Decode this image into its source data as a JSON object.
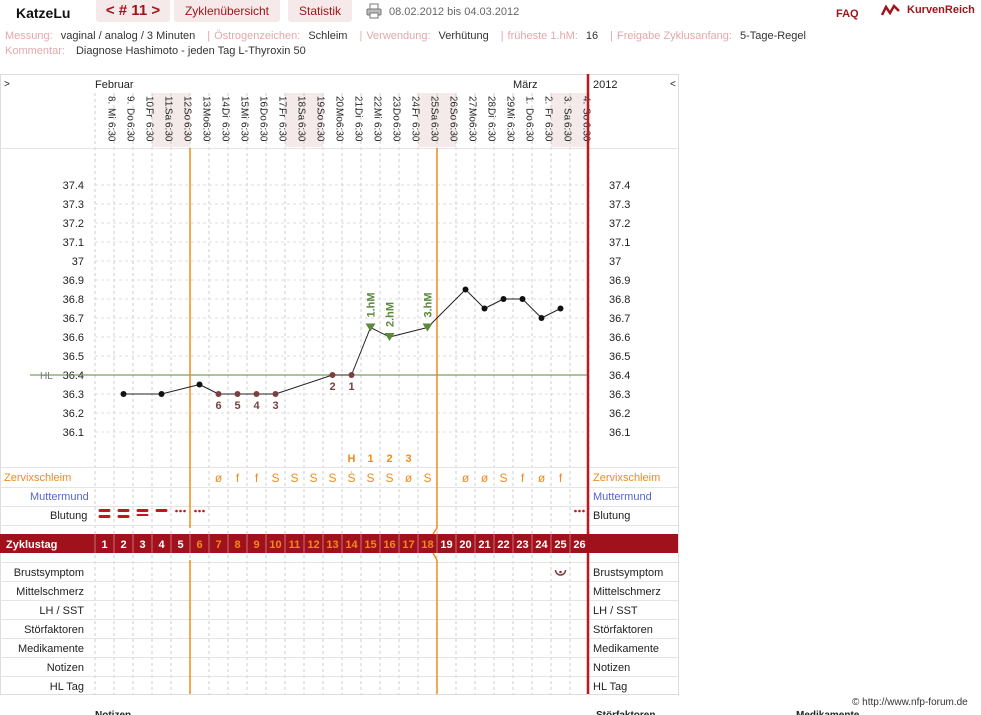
{
  "header": {
    "user": "KatzeLu",
    "cycle_nav": "< # 11 >",
    "tabs": [
      "Zyklenübersicht",
      "Statistik"
    ],
    "date_range": "08.02.2012 bis 04.03.2012",
    "faq": "FAQ",
    "brand": "KurvenReich"
  },
  "meta": {
    "line1": [
      {
        "k": "Messung:",
        "v": "vaginal / analog / 3 Minuten"
      },
      {
        "k": "Östrogenzeichen:",
        "v": "Schleim"
      },
      {
        "k": "Verwendung:",
        "v": "Verhütung"
      },
      {
        "k": "früheste 1.hM:",
        "v": "16"
      },
      {
        "k": "Freigabe Zyklusanfang:",
        "v": "5-Tage-Regel"
      }
    ],
    "comment_key": "Kommentar:",
    "comment": "Diagnose Hashimoto - jeden Tag L-Thyroxin 50"
  },
  "calendar": {
    "left_arrow": ">",
    "right_arrow": "<",
    "year": "2012",
    "months": [
      {
        "name": "Februar",
        "start_index": 0
      },
      {
        "name": "März",
        "start_index": 22
      }
    ],
    "days": [
      {
        "d": "8.",
        "w": "Mi",
        "t": "6:30",
        "we": false
      },
      {
        "d": "9.",
        "w": "Do",
        "t": "6:30",
        "we": false
      },
      {
        "d": "10.",
        "w": "Fr",
        "t": "6:30",
        "we": false
      },
      {
        "d": "11.",
        "w": "Sa",
        "t": "6:30",
        "we": true
      },
      {
        "d": "12.",
        "w": "So",
        "t": "6:30",
        "we": true
      },
      {
        "d": "13.",
        "w": "Mo",
        "t": "6:30",
        "we": false
      },
      {
        "d": "14.",
        "w": "Di",
        "t": "6:30",
        "we": false
      },
      {
        "d": "15.",
        "w": "Mi",
        "t": "6:30",
        "we": false
      },
      {
        "d": "16.",
        "w": "Do",
        "t": "6:30",
        "we": false
      },
      {
        "d": "17.",
        "w": "Fr",
        "t": "6:30",
        "we": false
      },
      {
        "d": "18.",
        "w": "Sa",
        "t": "6:30",
        "we": true
      },
      {
        "d": "19.",
        "w": "So",
        "t": "6:30",
        "we": true
      },
      {
        "d": "20.",
        "w": "Mo",
        "t": "6:30",
        "we": false
      },
      {
        "d": "21.",
        "w": "Di",
        "t": "6:30",
        "we": false
      },
      {
        "d": "22.",
        "w": "Mi",
        "t": "6:30",
        "we": false
      },
      {
        "d": "23.",
        "w": "Do",
        "t": "6:30",
        "we": false
      },
      {
        "d": "24.",
        "w": "Fr",
        "t": "6:30",
        "we": false
      },
      {
        "d": "25.",
        "w": "Sa",
        "t": "6:30",
        "we": true
      },
      {
        "d": "26.",
        "w": "So",
        "t": "6:30",
        "we": true
      },
      {
        "d": "27.",
        "w": "Mo",
        "t": "6:30",
        "we": false
      },
      {
        "d": "28.",
        "w": "Di",
        "t": "6:30",
        "we": false
      },
      {
        "d": "29.",
        "w": "Mi",
        "t": "6:30",
        "we": false
      },
      {
        "d": "1.",
        "w": "Do",
        "t": "6:30",
        "we": false
      },
      {
        "d": "2.",
        "w": "Fr",
        "t": "6:30",
        "we": false
      },
      {
        "d": "3.",
        "w": "Sa",
        "t": "6:30",
        "we": true
      },
      {
        "d": "4.",
        "w": "So",
        "t": "6:30",
        "we": true
      }
    ]
  },
  "chart_data": {
    "type": "line",
    "y_ticks": [
      "37.4",
      "37.3",
      "37.2",
      "37.1",
      "37",
      "36.9",
      "36.8",
      "36.7",
      "36.6",
      "36.5",
      "36.4",
      "36.3",
      "36.2",
      "36.1"
    ],
    "ylim": [
      36.05,
      37.45
    ],
    "hl_label": "HL",
    "hl_value": 36.4,
    "temps": [
      null,
      36.3,
      null,
      36.3,
      null,
      36.35,
      36.3,
      36.3,
      36.3,
      36.3,
      null,
      null,
      36.4,
      36.4,
      36.65,
      36.6,
      null,
      36.65,
      null,
      36.85,
      36.75,
      36.8,
      36.8,
      36.7,
      36.75,
      null
    ],
    "low_counts": [
      {
        "day": 7,
        "label": "6"
      },
      {
        "day": 8,
        "label": "5"
      },
      {
        "day": 9,
        "label": "4"
      },
      {
        "day": 10,
        "label": "3"
      },
      {
        "day": 13,
        "label": "2"
      },
      {
        "day": 14,
        "label": "1"
      }
    ],
    "high_markers": [
      {
        "day": 15,
        "label": "1.hM"
      },
      {
        "day": 16,
        "label": "2.hM"
      },
      {
        "day": 18,
        "label": "3.hM"
      }
    ],
    "peak_markers": [
      {
        "day": 14,
        "label": "H"
      },
      {
        "day": 15,
        "label": "1"
      },
      {
        "day": 16,
        "label": "2"
      },
      {
        "day": 17,
        "label": "3"
      }
    ],
    "vlines_after_day": [
      5,
      18
    ],
    "colors": {
      "line": "#222222",
      "orange": "#f08a1c",
      "red": "#c0171c",
      "green": "#5a8a3a",
      "brown": "#7a4040",
      "cycle_bg": "#a1111c"
    }
  },
  "rows": {
    "zervix": {
      "label": "Zervixschleim",
      "values": [
        "",
        "",
        "",
        "",
        "",
        "",
        "ø",
        "f",
        "f",
        "S",
        "S",
        "S",
        "S",
        "Ṡ",
        "S",
        "S",
        "ø",
        "S",
        "",
        "ø",
        "ø",
        "S",
        "f",
        "ø",
        "f",
        ""
      ]
    },
    "muttermund": {
      "label": "Muttermund"
    },
    "blutung": {
      "label": "Blutung",
      "values": [
        "heavy",
        "heavy",
        "medium",
        "light",
        "spot",
        "spot",
        "",
        "",
        "",
        "",
        "",
        "",
        "",
        "",
        "",
        "",
        "",
        "",
        "",
        "",
        "",
        "",
        "",
        "",
        "",
        "spot"
      ]
    },
    "zyklustag": {
      "label": "Zyklustag",
      "values": [
        "1",
        "2",
        "3",
        "4",
        "5",
        "6",
        "7",
        "8",
        "9",
        "10",
        "11",
        "12",
        "13",
        "14",
        "15",
        "16",
        "17",
        "18",
        "19",
        "20",
        "21",
        "22",
        "23",
        "24",
        "25",
        "26"
      ],
      "fertile_from": 6,
      "fertile_to": 18
    },
    "extra": [
      "Brustsymptom",
      "Mittelschmerz",
      "LH / SST",
      "Störfaktoren",
      "Medikamente",
      "Notizen",
      "HL Tag"
    ],
    "brust_day": 25
  },
  "footer": {
    "copyright": "© http://www.nfp-forum.de",
    "bottom_labels": [
      "Notizen",
      "Störfaktoren",
      "Medikamente"
    ]
  }
}
